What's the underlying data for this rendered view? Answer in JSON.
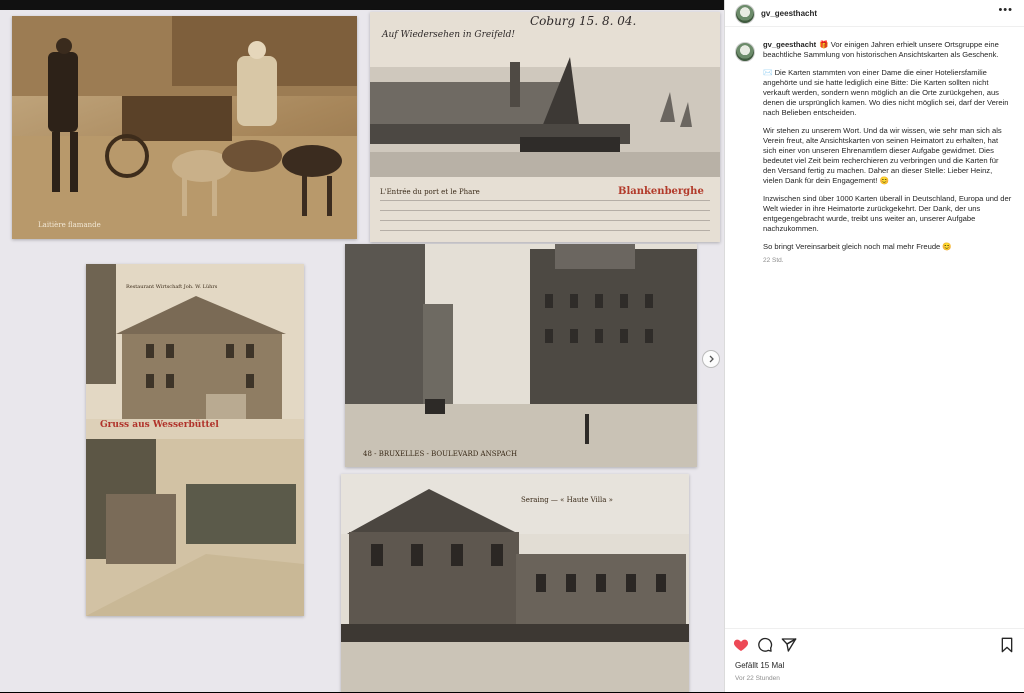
{
  "post": {
    "username": "gv_geesthacht",
    "more_label": "•••",
    "gift_emoji": "🎁",
    "caption_paragraphs": [
      "Vor einigen Jahren erhielt unsere Ortsgruppe eine beachtliche Sammlung von historischen Ansichtskarten als Geschenk.",
      "✉️ Die Karten stammten von einer Dame die einer Hoteliersfamilie angehörte und sie hatte lediglich eine Bitte: Die Karten sollten nicht verkauft werden, sondern wenn möglich an die Orte zurückgehen, aus denen die ursprünglich kamen. Wo dies nicht möglich sei, darf der Verein nach Belieben entscheiden.",
      "Wir stehen zu unserem Wort. Und da wir wissen, wie sehr man sich als Verein freut, alte Ansichtskarten von seinen Heimatort zu erhalten, hat sich einer von unseren Ehrenamtlern dieser Aufgabe gewidmet. Dies bedeutet viel Zeit beim recherchieren zu verbringen und die Karten für den Versand fertig zu machen. Daher an dieser Stelle: Lieber Heinz, vielen Dank für dein Engagement! 😊",
      "Inzwischen sind über 1000 Karten überall in Deutschland, Europa und der Welt wieder in ihre Heimatorte zurückgekehrt. Der Dank, der uns entgegengebracht wurde, treibt uns weiter an, unserer Aufgabe nachzukommen.",
      "So bringt Vereinsarbeit gleich noch mal mehr Freude 😊"
    ],
    "time_ago": "22 Std.",
    "likes_label": "Gefällt 15 Mal",
    "posted_ago": "Vor 22 Stunden"
  },
  "postcards": {
    "card1_caption": "Laitière flamande",
    "card2_caption": "L'Entrée du port et le Phare",
    "card2_place": "Blankenberghe",
    "card2_hand_top": "Coburg 15. 8. 04.",
    "card3_title": "Gruss aus Wesserbüttel",
    "card3_sign": "Restaurant Wirtschaft Joh. W. Lührs",
    "card4_caption": "48 - BRUXELLES - BOULEVARD ANSPACH",
    "card5_caption": "Seraing — « Haute Villa »"
  },
  "icons": {
    "next": "chevron-right-icon",
    "like": "heart-icon",
    "comment": "comment-icon",
    "share": "share-icon",
    "save": "bookmark-icon"
  },
  "colors": {
    "like_red": "#ed4956",
    "text": "#262626",
    "muted": "#8e8e8e"
  }
}
